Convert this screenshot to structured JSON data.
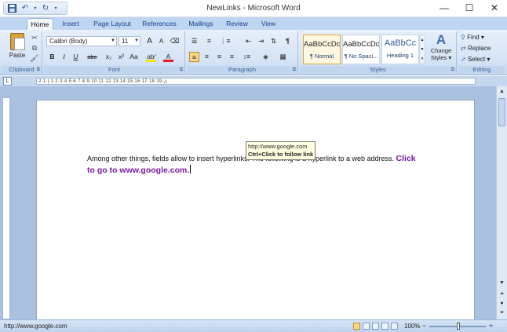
{
  "window": {
    "title": "NewLinks - Microsoft Word",
    "minimize_glyph": "—",
    "maximize_glyph": "☐",
    "close_glyph": "✕"
  },
  "quick_access": {
    "save_icon": "save-icon",
    "undo_icon": "undo-icon",
    "redo_icon": "redo-icon"
  },
  "tabs": [
    {
      "label": "Home",
      "active": true
    },
    {
      "label": "Insert"
    },
    {
      "label": "Page Layout"
    },
    {
      "label": "References"
    },
    {
      "label": "Mailings"
    },
    {
      "label": "Review"
    },
    {
      "label": "View"
    }
  ],
  "clipboard": {
    "paste_label": "Paste",
    "group_label": "Clipboard"
  },
  "font": {
    "font_name": "Calibri (Body)",
    "font_size": "11",
    "group_label": "Font",
    "bold": "B",
    "italic": "I",
    "underline": "U",
    "strikethrough": "abe",
    "subscript": "x₂",
    "superscript": "x²",
    "change_case": "Aa",
    "grow": "A",
    "shrink": "A",
    "highlight": "ab⁄",
    "font_color": "A"
  },
  "paragraph": {
    "group_label": "Paragraph",
    "pilcrow": "¶"
  },
  "styles": {
    "group_label": "Styles",
    "items": [
      {
        "sample": "AaBbCcDc",
        "name": "¶ Normal",
        "selected": true
      },
      {
        "sample": "AaBbCcDc",
        "name": "¶ No Spaci..."
      },
      {
        "sample": "AaBbCc",
        "name": "Heading 1"
      }
    ],
    "change_styles_label": "Change",
    "change_styles_label2": "Styles ▾"
  },
  "editing": {
    "group_label": "Editing",
    "find_label": "Find ▾",
    "replace_label": "Replace",
    "select_label": "Select ▾"
  },
  "ruler": {
    "scale": "·2·1·|·1·2·3·4·5·6·7·8·9·10·11·12·13·14·15·16·17·18·19·△"
  },
  "document": {
    "text_before": "Among other things, fields allow to insert hyperlinks. The following is a hyperlink to a web address. ",
    "hyperlink_text": "Click to go to www.google.com.",
    "tooltip_url": "http://www.google.com",
    "tooltip_hint": "Ctrl+Click to follow link"
  },
  "statusbar": {
    "status_text": "http://www.google.com",
    "zoom": "100%",
    "zoom_minus": "−",
    "zoom_plus": "+"
  },
  "colors": {
    "hyperlink": "#7a1ca8",
    "ribbon": "#d4e3f5",
    "docarea": "#a9c0df"
  }
}
